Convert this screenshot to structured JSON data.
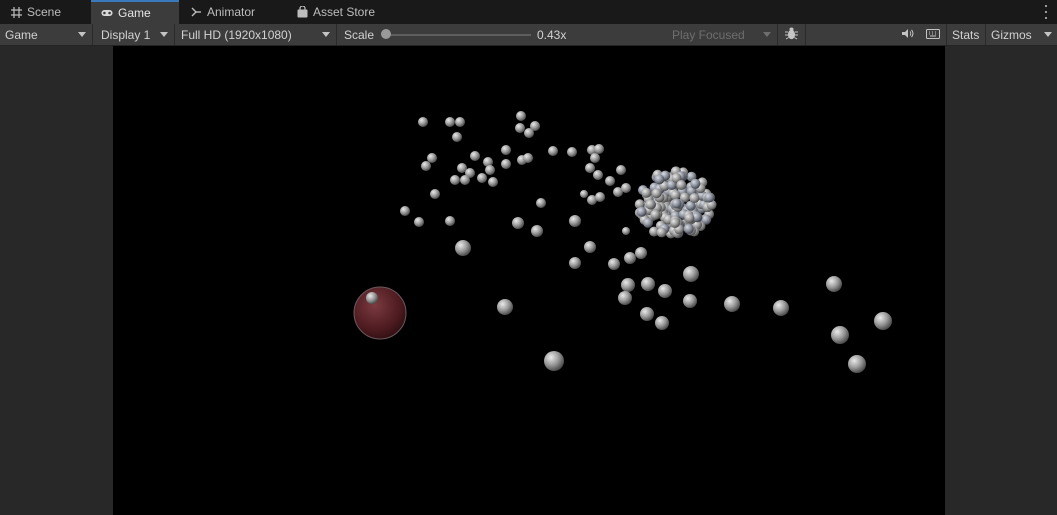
{
  "tabs": [
    {
      "label": "Scene",
      "icon": "grid-icon"
    },
    {
      "label": "Game",
      "icon": "gamepad-icon"
    },
    {
      "label": "Animator",
      "icon": "animator-icon"
    },
    {
      "label": "Asset Store",
      "icon": "shopping-bag-icon"
    }
  ],
  "toolbar": {
    "view_mode": "Game",
    "display": "Display 1",
    "resolution": "Full HD (1920x1080)",
    "scale_label": "Scale",
    "scale_value": "0.43x",
    "scale_fraction": 0.0,
    "play_mode": "Play Focused",
    "stats_label": "Stats",
    "gizmos_label": "Gizmos"
  },
  "colors": {
    "tab_active_accent": "#3a79bb",
    "game_background": "#000000",
    "sphere_color": "#b9b9b9",
    "player_sphere_color": "#5a1e24"
  }
}
